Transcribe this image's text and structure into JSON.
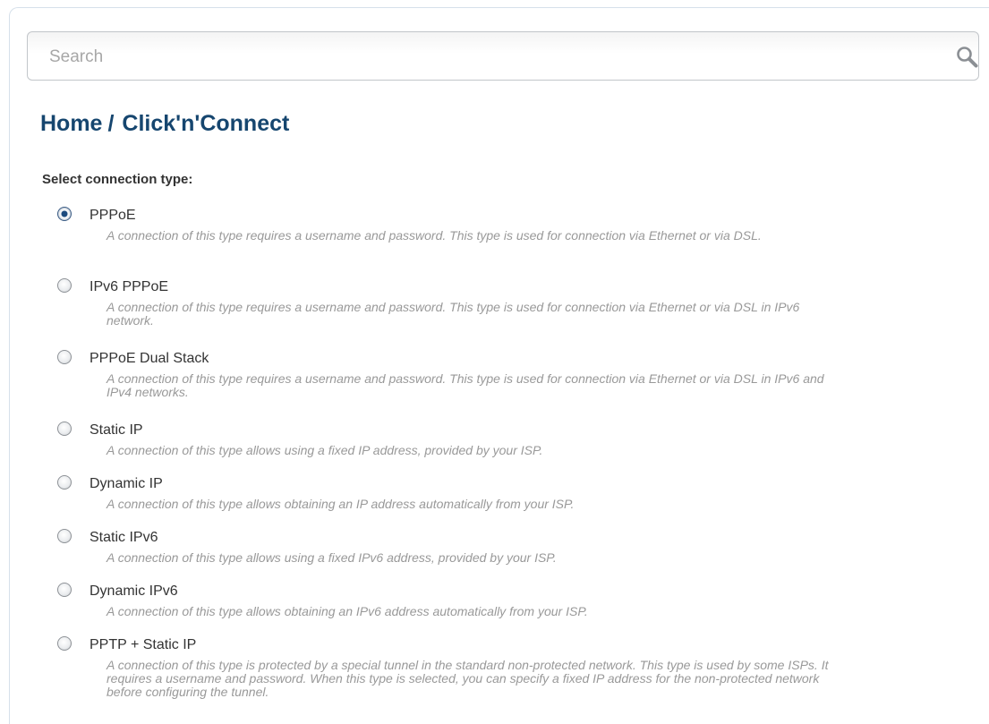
{
  "search": {
    "placeholder": "Search",
    "value": ""
  },
  "breadcrumb": {
    "home": "Home",
    "separator": "/",
    "current": "Click'n'Connect"
  },
  "prompt": "Select connection type:",
  "options": [
    {
      "label": "PPPoE",
      "selected": true,
      "description": "A connection of this type requires a username and password. This type is used for connection via Ethernet or via DSL."
    },
    {
      "label": "IPv6 PPPoE",
      "selected": false,
      "description": "A connection of this type requires a username and password. This type is used for connection via Ethernet or via DSL in IPv6 network."
    },
    {
      "label": "PPPoE Dual Stack",
      "selected": false,
      "description": "A connection of this type requires a username and password. This type is used for connection via Ethernet or via DSL in IPv6 and IPv4 networks."
    },
    {
      "label": "Static IP",
      "selected": false,
      "description": "A connection of this type allows using a fixed IP address, provided by your ISP."
    },
    {
      "label": "Dynamic IP",
      "selected": false,
      "description": "A connection of this type allows obtaining an IP address automatically from your ISP."
    },
    {
      "label": "Static IPv6",
      "selected": false,
      "description": "A connection of this type allows using a fixed IPv6 address, provided by your ISP."
    },
    {
      "label": "Dynamic IPv6",
      "selected": false,
      "description": "A connection of this type allows obtaining an IPv6 address automatically from your ISP."
    },
    {
      "label": "PPTP + Static IP",
      "selected": false,
      "description": "A connection of this type is protected by a special tunnel in the standard non-protected network. This type is used by some ISPs. It requires a username and password. When this type is selected, you can specify a fixed IP address for the non-protected network before configuring the tunnel."
    }
  ],
  "colors": {
    "title": "#16466f",
    "label": "#333333",
    "description": "#999999",
    "radio_checked": "#1b4a7e"
  },
  "icons": {
    "search": "search-icon"
  }
}
